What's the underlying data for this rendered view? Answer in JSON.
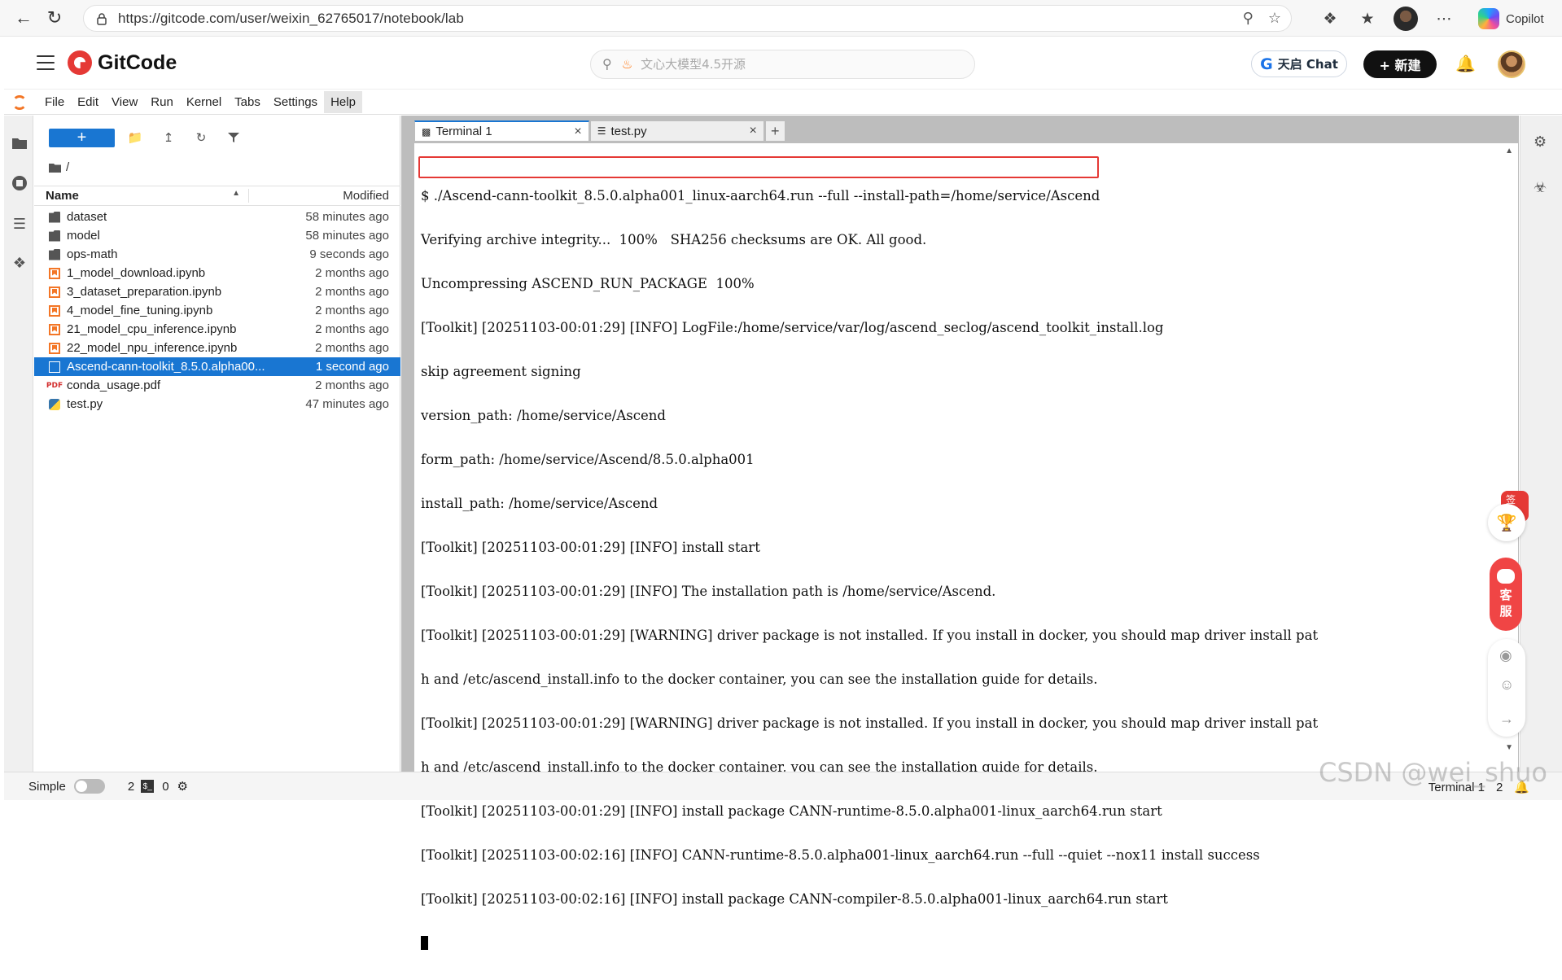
{
  "browser": {
    "url": "https://gitcode.com/user/weixin_62765017/notebook/lab",
    "copilot_label": "Copilot"
  },
  "gitcode": {
    "logo_text": "GitCode",
    "search_placeholder": "文心大模型4.5开源",
    "tianqi_label": "天启 Chat",
    "new_label": "+ 新建"
  },
  "menubar": {
    "items": [
      "File",
      "Edit",
      "View",
      "Run",
      "Kernel",
      "Tabs",
      "Settings",
      "Help"
    ]
  },
  "file_browser": {
    "new_label": "+",
    "path": "/",
    "col_name": "Name",
    "col_modified": "Modified",
    "files": [
      {
        "name": "dataset",
        "modified": "58 minutes ago",
        "type": "folder"
      },
      {
        "name": "model",
        "modified": "58 minutes ago",
        "type": "folder"
      },
      {
        "name": "ops-math",
        "modified": "9 seconds ago",
        "type": "folder"
      },
      {
        "name": "1_model_download.ipynb",
        "modified": "2 months ago",
        "type": "notebook"
      },
      {
        "name": "3_dataset_preparation.ipynb",
        "modified": "2 months ago",
        "type": "notebook"
      },
      {
        "name": "4_model_fine_tuning.ipynb",
        "modified": "2 months ago",
        "type": "notebook"
      },
      {
        "name": "21_model_cpu_inference.ipynb",
        "modified": "2 months ago",
        "type": "notebook"
      },
      {
        "name": "22_model_npu_inference.ipynb",
        "modified": "2 months ago",
        "type": "notebook"
      },
      {
        "name": "Ascend-cann-toolkit_8.5.0.alpha00...",
        "modified": "1 second ago",
        "type": "file"
      },
      {
        "name": "conda_usage.pdf",
        "modified": "2 months ago",
        "type": "pdf"
      },
      {
        "name": "test.py",
        "modified": "47 minutes ago",
        "type": "python"
      }
    ]
  },
  "tabs": [
    {
      "label": "Terminal 1",
      "icon": "terminal-icon"
    },
    {
      "label": "test.py",
      "icon": "text-file-icon"
    }
  ],
  "terminal": {
    "lines": [
      "$ ./Ascend-cann-toolkit_8.5.0.alpha001_linux-aarch64.run --full --install-path=/home/service/Ascend",
      "Verifying archive integrity...  100%   SHA256 checksums are OK. All good.",
      "Uncompressing ASCEND_RUN_PACKAGE  100%",
      "[Toolkit] [20251103-00:01:29] [INFO] LogFile:/home/service/var/log/ascend_seclog/ascend_toolkit_install.log",
      "skip agreement signing",
      "version_path: /home/service/Ascend",
      "form_path: /home/service/Ascend/8.5.0.alpha001",
      "install_path: /home/service/Ascend",
      "[Toolkit] [20251103-00:01:29] [INFO] install start",
      "[Toolkit] [20251103-00:01:29] [INFO] The installation path is /home/service/Ascend.",
      "[Toolkit] [20251103-00:01:29] [WARNING] driver package is not installed. If you install in docker, you should map driver install pat",
      "h and /etc/ascend_install.info to the docker container, you can see the installation guide for details.",
      "[Toolkit] [20251103-00:01:29] [WARNING] driver package is not installed. If you install in docker, you should map driver install pat",
      "h and /etc/ascend_install.info to the docker container, you can see the installation guide for details.",
      "[Toolkit] [20251103-00:01:29] [INFO] install package CANN-runtime-8.5.0.alpha001-linux_aarch64.run start",
      "[Toolkit] [20251103-00:02:16] [INFO] CANN-runtime-8.5.0.alpha001-linux_aarch64.run --full --quiet --nox11 install success",
      "[Toolkit] [20251103-00:02:16] [INFO] install package CANN-compiler-8.5.0.alpha001-linux_aarch64.run start"
    ]
  },
  "floating": {
    "sign_label": "签到",
    "kefu_label_1": "客",
    "kefu_label_2": "服"
  },
  "statusbar": {
    "simple_label": "Simple",
    "terminals_count": "2",
    "kernels_count": "0",
    "right_label": "Terminal 1",
    "right_count": "2"
  },
  "watermark": "CSDN @wei_shuo"
}
